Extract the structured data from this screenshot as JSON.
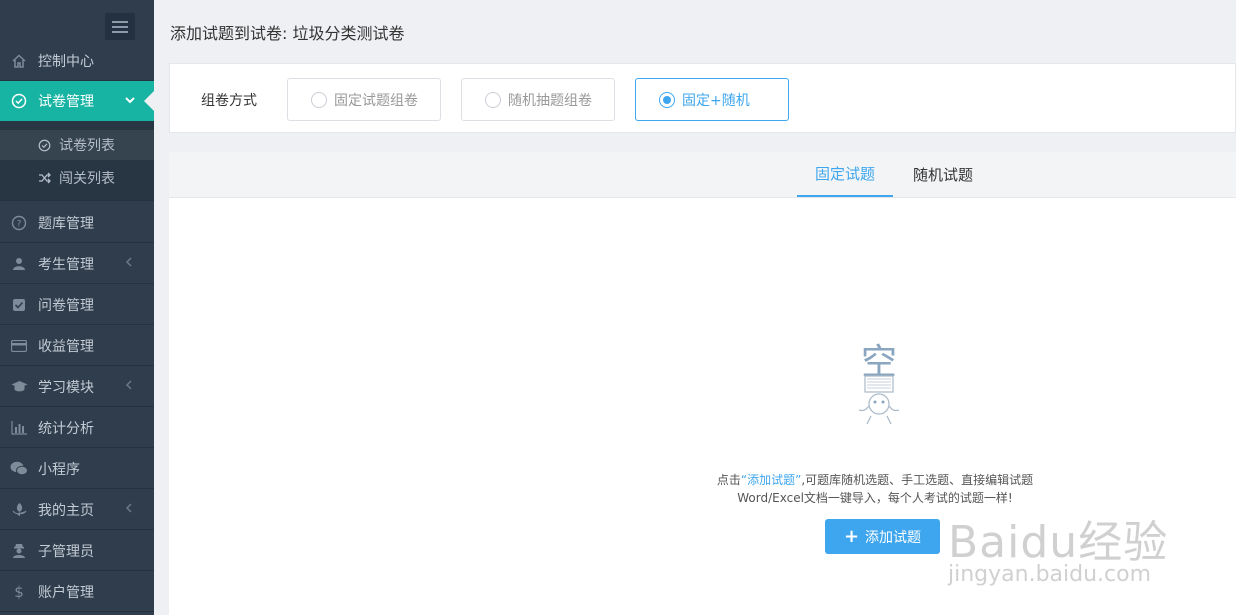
{
  "sidebar": {
    "items": [
      {
        "label": "控制中心",
        "icon": "home-icon"
      },
      {
        "label": "试卷管理",
        "icon": "check-circle-icon",
        "expanded": true
      },
      {
        "label": "题库管理",
        "icon": "question-circle-icon"
      },
      {
        "label": "考生管理",
        "icon": "user-icon"
      },
      {
        "label": "问卷管理",
        "icon": "checkbox-icon"
      },
      {
        "label": "收益管理",
        "icon": "credit-card-icon"
      },
      {
        "label": "学习模块",
        "icon": "graduation-cap-icon"
      },
      {
        "label": "统计分析",
        "icon": "bar-chart-icon"
      },
      {
        "label": "小程序",
        "icon": "wechat-icon"
      },
      {
        "label": "我的主页",
        "icon": "leaf-icon"
      },
      {
        "label": "子管理员",
        "icon": "user-secret-icon"
      },
      {
        "label": "账户管理",
        "icon": "dollar-icon"
      }
    ],
    "submenu": [
      {
        "label": "试卷列表",
        "icon": "check-circle-icon"
      },
      {
        "label": "闯关列表",
        "icon": "shuffle-icon"
      }
    ]
  },
  "header": {
    "title": "添加试题到试卷: 垃圾分类测试卷"
  },
  "mode": {
    "label": "组卷方式",
    "options": [
      "固定试题组卷",
      "随机抽题组卷",
      "固定+随机"
    ],
    "selected": "固定+随机"
  },
  "tabs": [
    "固定试题",
    "随机试题"
  ],
  "empty": {
    "illustration_text": "空",
    "line1_prefix": "点击",
    "line1_link": "“添加试题”",
    "line1_suffix": ",可题库随机选题、手工选题、直接编辑试题",
    "line2": "Word/Excel文档一键导入，每个人考试的试题一样!",
    "button": "添加试题"
  },
  "watermark": {
    "brand": "Baidu经验",
    "url": "jingyan.baidu.com"
  },
  "colors": {
    "accent": "#3ea6ee",
    "active_menu": "#17b3a3",
    "sidebar_bg": "#2f3d4c"
  }
}
